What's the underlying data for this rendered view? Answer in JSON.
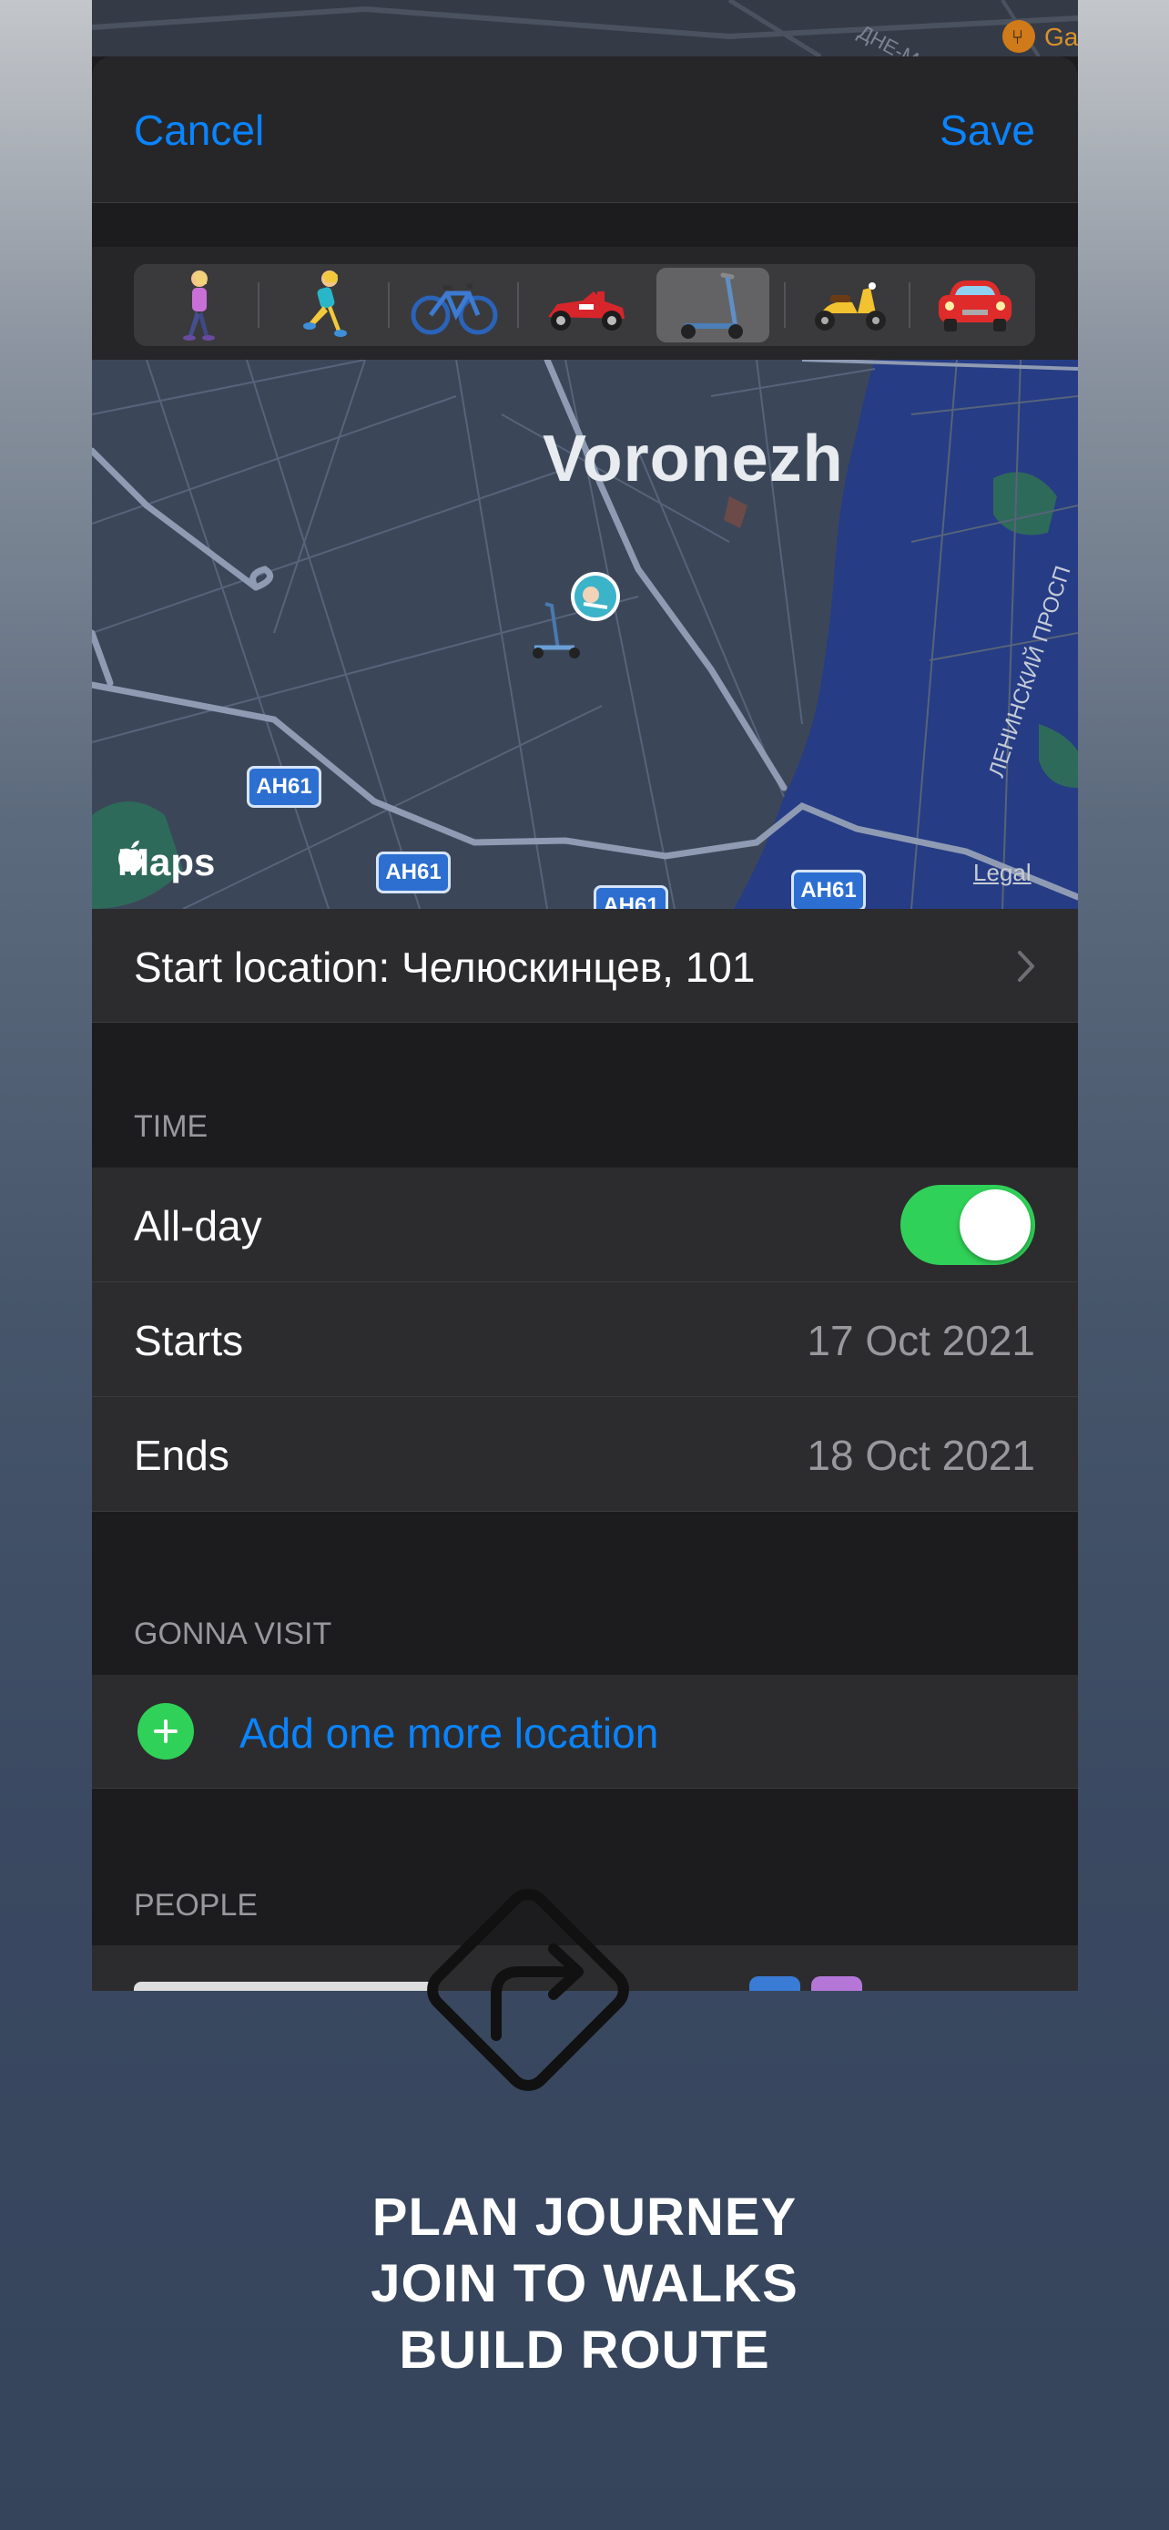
{
  "nav": {
    "cancel_label": "Cancel",
    "save_label": "Save"
  },
  "transport_modes": [
    {
      "name": "walking",
      "emoji": "🚶‍♀️"
    },
    {
      "name": "running",
      "emoji": "🏃‍♀️"
    },
    {
      "name": "bicycle",
      "emoji": "🚲"
    },
    {
      "name": "race-car",
      "emoji": "🏎️"
    },
    {
      "name": "kick-scooter",
      "emoji": "🛴",
      "selected": true
    },
    {
      "name": "motor-scooter",
      "emoji": "🛵"
    },
    {
      "name": "car",
      "emoji": "🚗"
    }
  ],
  "map": {
    "city_label": "Voronezh",
    "road_shield": "AH61",
    "brand": "Maps",
    "legal": "Legal",
    "street_label": "ЛЕНИНСКИЙ ПРОСП",
    "top_street_label": "ДНЕ-М",
    "poi_label": "Ga",
    "water_color": "#263c85",
    "route_color": "#8f9bb3"
  },
  "start_location": {
    "label": "Start location: Челюскинцев, 101"
  },
  "time": {
    "header": "TIME",
    "all_day_label": "All-day",
    "all_day_on": true,
    "starts_label": "Starts",
    "starts_value": "17 Oct 2021",
    "ends_label": "Ends",
    "ends_value": "18 Oct 2021"
  },
  "visit": {
    "header": "GONNA VISIT",
    "add_label": "Add one more location"
  },
  "people": {
    "header": "PEOPLE"
  },
  "promo": {
    "line1": "PLAN JOURNEY",
    "line2": "JOIN TO WALKS",
    "line3": "BUILD ROUTE"
  },
  "colors": {
    "accent": "#0a84ff",
    "toggle_on": "#30d158",
    "sheet_bg": "#1c1c1e",
    "row_bg": "#2c2c2e"
  }
}
